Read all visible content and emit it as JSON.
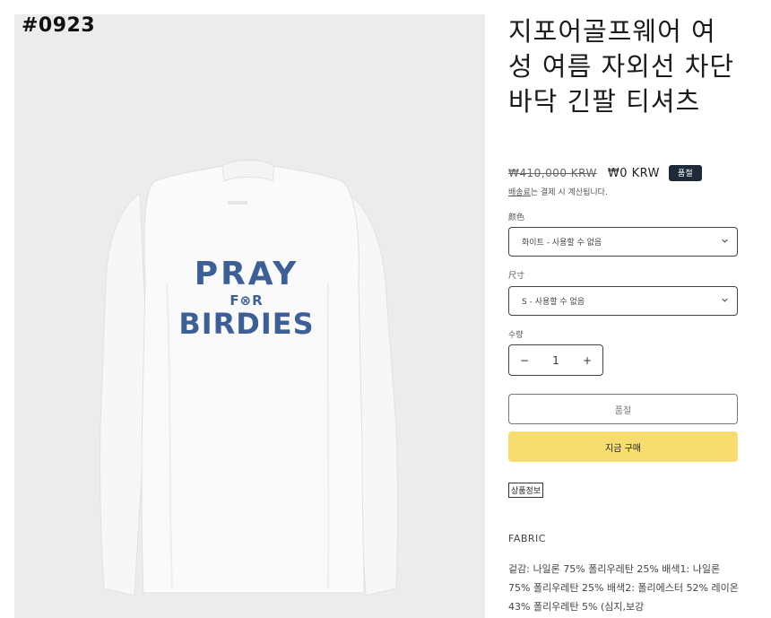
{
  "image": {
    "code_label": "#0923",
    "print": {
      "line1": "PRAY",
      "line2": "F⊗R",
      "line3": "BIRDIES"
    },
    "print_color": "#3d5f98",
    "background": "#ececec"
  },
  "product": {
    "title": "지포어골프웨어 여성 여름 자외선 차단 바닥 긴팔 티셔츠",
    "price_original": "₩410,000 KRW",
    "price_sale": "₩0 KRW",
    "badge": "품절",
    "shipping_link": "배송료",
    "shipping_text": "는 결제 시 계산됩니다."
  },
  "options": {
    "color_label": "颜色",
    "color_value": "화이트 - 사용할 수 없음",
    "size_label": "尺寸",
    "size_value": "S - 사용할 수 없음",
    "qty_label": "수량",
    "qty_minus": "−",
    "qty_value": "1",
    "qty_plus": "+"
  },
  "actions": {
    "soldout_label": "품절",
    "buy_label": "지금 구매",
    "buy_color": "#f7dc6f"
  },
  "details": {
    "tab_label": "상품정보",
    "fabric_heading": "FABRIC",
    "fabric_text": "겉감: 나일론 75% 폴리우레탄 25% 배색1: 나일론 75% 폴리우레탄 25% 배색2: 폴리에스터 52% 레이온 43% 폴리우레탄 5% (심지,보강"
  }
}
